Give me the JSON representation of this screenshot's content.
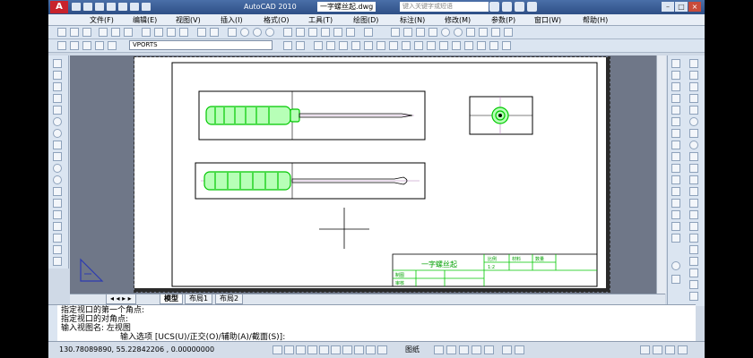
{
  "window": {
    "app_title": "AutoCAD 2010",
    "file_name": "一字螺丝起.dwg",
    "search_placeholder": "键入关键字或短语"
  },
  "menu": [
    "文件(F)",
    "编辑(E)",
    "视图(V)",
    "插入(I)",
    "格式(O)",
    "工具(T)",
    "绘图(D)",
    "标注(N)",
    "修改(M)",
    "参数(P)",
    "窗口(W)",
    "帮助(H)"
  ],
  "layer_dropdown": {
    "value": "VPORTS"
  },
  "layout_tabs": {
    "model": "模型",
    "layout1": "布局1",
    "layout2": "布局2"
  },
  "drawing": {
    "title_block": {
      "part_name": "一字螺丝起",
      "scale_label": "比例",
      "material_label": "材料",
      "qty_label": "数量",
      "scale_value": "1:2",
      "drawn_by": "制图",
      "checked_by": "审核"
    }
  },
  "command_history": [
    "指定视口的第一个角点:",
    "指定视口的对角点:",
    "输入视图名: 左视图"
  ],
  "command_prompt": "输入选项 [UCS(U)/正交(O)/辅助(A)/截面(S)]:",
  "status": {
    "coordinates": "130.78089890, 55.22842206 , 0.00000000",
    "paper_label": "图纸"
  },
  "colors": {
    "accent_green": "#00e600",
    "title_bar": "#3a5f9a"
  }
}
